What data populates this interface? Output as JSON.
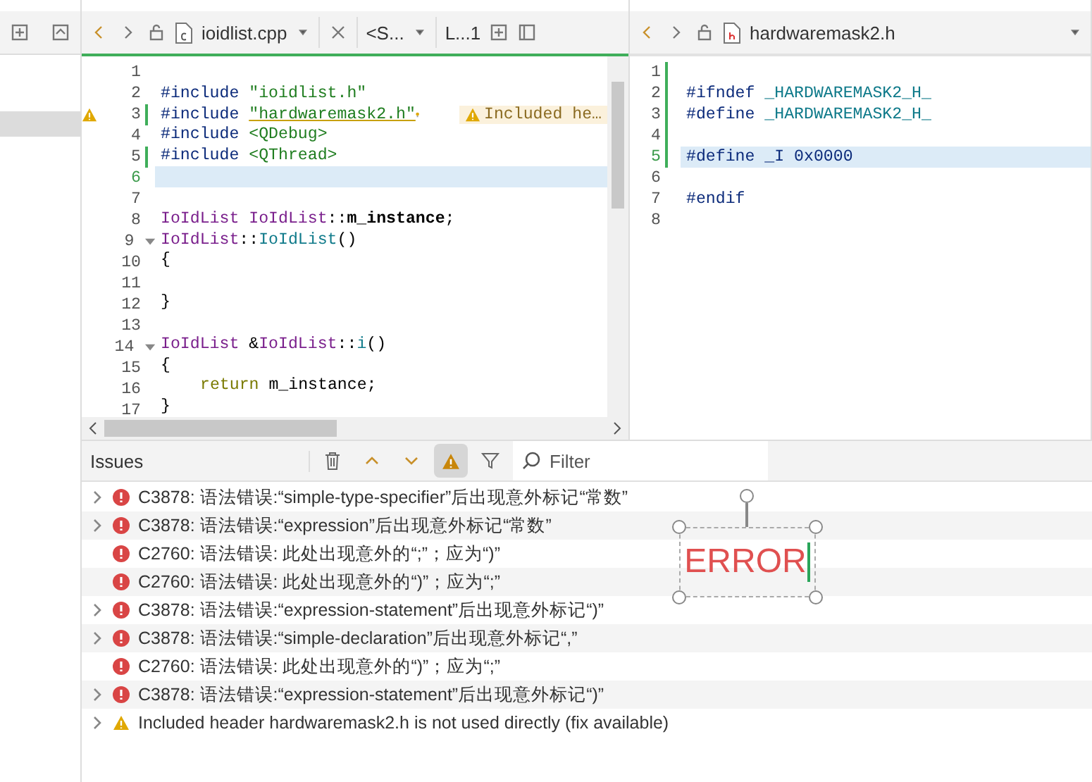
{
  "editors": [
    {
      "active": true,
      "file": {
        "name": "ioidlist.cpp",
        "kind": "cpp"
      },
      "symbol": "<S...",
      "position": "L...1",
      "lines": [
        {
          "number": "1"
        },
        {
          "number": "2",
          "tokens": [
            {
              "kind": "pre",
              "text": "#include "
            },
            {
              "kind": "str",
              "text": "\"ioidlist.h\""
            }
          ]
        },
        {
          "number": "3",
          "changed": true,
          "warning": true,
          "tokens": [
            {
              "kind": "pre",
              "text": "#include "
            },
            {
              "kind": "str",
              "text": "\"hardwaremask2.h\""
            }
          ],
          "annotation": "Included he…"
        },
        {
          "number": "4",
          "tokens": [
            {
              "kind": "pre",
              "text": "#include "
            },
            {
              "kind": "str",
              "text": "<QDebug>"
            }
          ]
        },
        {
          "number": "5",
          "changed": true,
          "tokens": [
            {
              "kind": "pre",
              "text": "#include "
            },
            {
              "kind": "str",
              "text": "<QThread>"
            }
          ]
        },
        {
          "number": "6",
          "current": true
        },
        {
          "number": "7"
        },
        {
          "number": "8",
          "tokens": [
            {
              "kind": "type",
              "text": "IoIdList "
            },
            {
              "kind": "type",
              "text": "IoIdList"
            },
            {
              "kind": "plain",
              "text": "::"
            },
            {
              "kind": "member",
              "text": "m_instance"
            },
            {
              "kind": "plain",
              "text": ";"
            }
          ]
        },
        {
          "number": "9",
          "fold": true,
          "tokens": [
            {
              "kind": "type",
              "text": "IoIdList"
            },
            {
              "kind": "plain",
              "text": "::"
            },
            {
              "kind": "func",
              "text": "IoIdList"
            },
            {
              "kind": "plain",
              "text": "()"
            }
          ]
        },
        {
          "number": "10",
          "tokens": [
            {
              "kind": "plain",
              "text": "{"
            }
          ]
        },
        {
          "number": "11"
        },
        {
          "number": "12",
          "tokens": [
            {
              "kind": "plain",
              "text": "}"
            }
          ]
        },
        {
          "number": "13"
        },
        {
          "number": "14",
          "fold": true,
          "tokens": [
            {
              "kind": "type",
              "text": "IoIdList"
            },
            {
              "kind": "plain",
              "text": " &"
            },
            {
              "kind": "type",
              "text": "IoIdList"
            },
            {
              "kind": "plain",
              "text": "::"
            },
            {
              "kind": "func",
              "text": "i"
            },
            {
              "kind": "plain",
              "text": "()"
            }
          ]
        },
        {
          "number": "15",
          "tokens": [
            {
              "kind": "plain",
              "text": "{"
            }
          ]
        },
        {
          "number": "16",
          "indented": true,
          "tokens": [
            {
              "kind": "kw",
              "text": "return"
            },
            {
              "kind": "plain",
              "text": " m_instance;"
            }
          ]
        },
        {
          "number": "17",
          "tokens": [
            {
              "kind": "plain",
              "text": "}"
            }
          ]
        }
      ]
    },
    {
      "active": false,
      "file": {
        "name": "hardwaremask2.h",
        "kind": "h"
      },
      "lines": [
        {
          "number": "1",
          "changed": true
        },
        {
          "number": "2",
          "changed": true,
          "tokens": [
            {
              "kind": "pre",
              "text": "#ifndef "
            },
            {
              "kind": "macro",
              "text": "_HARDWAREMASK2_H_"
            }
          ]
        },
        {
          "number": "3",
          "changed": true,
          "tokens": [
            {
              "kind": "pre",
              "text": "#define "
            },
            {
              "kind": "macro",
              "text": "_HARDWAREMASK2_H_"
            }
          ]
        },
        {
          "number": "4",
          "changed": true
        },
        {
          "number": "5",
          "changed": true,
          "current": true,
          "tokens": [
            {
              "kind": "pre",
              "text": "#define "
            },
            {
              "kind": "pre",
              "text": "_I 0x0000"
            }
          ]
        },
        {
          "number": "6"
        },
        {
          "number": "7",
          "tokens": [
            {
              "kind": "pre",
              "text": "#endif"
            }
          ]
        },
        {
          "number": "8"
        }
      ]
    }
  ],
  "issues": {
    "title": "Issues",
    "warnings_filter_on": true,
    "filter": {
      "placeholder": "Filter"
    },
    "rows": [
      {
        "expandable": true,
        "kind": "error",
        "text": "C3878: 语法错误:“simple-type-specifier”后出现意外标记“常数”"
      },
      {
        "expandable": true,
        "kind": "error",
        "text": "C3878: 语法错误:“expression”后出现意外标记“常数”"
      },
      {
        "expandable": false,
        "kind": "error",
        "text": "C2760: 语法错误: 此处出现意外的“;”；应为“)”"
      },
      {
        "expandable": false,
        "kind": "error",
        "text": "C2760: 语法错误: 此处出现意外的“)”；应为“;”"
      },
      {
        "expandable": true,
        "kind": "error",
        "text": "C3878: 语法错误:“expression-statement”后出现意外标记“)”"
      },
      {
        "expandable": true,
        "kind": "error",
        "text": "C3878: 语法错误:“simple-declaration”后出现意外标记“,”"
      },
      {
        "expandable": false,
        "kind": "error",
        "text": "C2760: 语法错误: 此处出现意外的“)”；应为“;”"
      },
      {
        "expandable": true,
        "kind": "error",
        "text": "C3878: 语法错误:“expression-statement”后出现意外标记“)”"
      },
      {
        "expandable": true,
        "kind": "warning",
        "text": "Included header hardwaremask2.h is not used directly (fix available)"
      }
    ]
  },
  "annotation_box": {
    "text": "ERROR"
  }
}
